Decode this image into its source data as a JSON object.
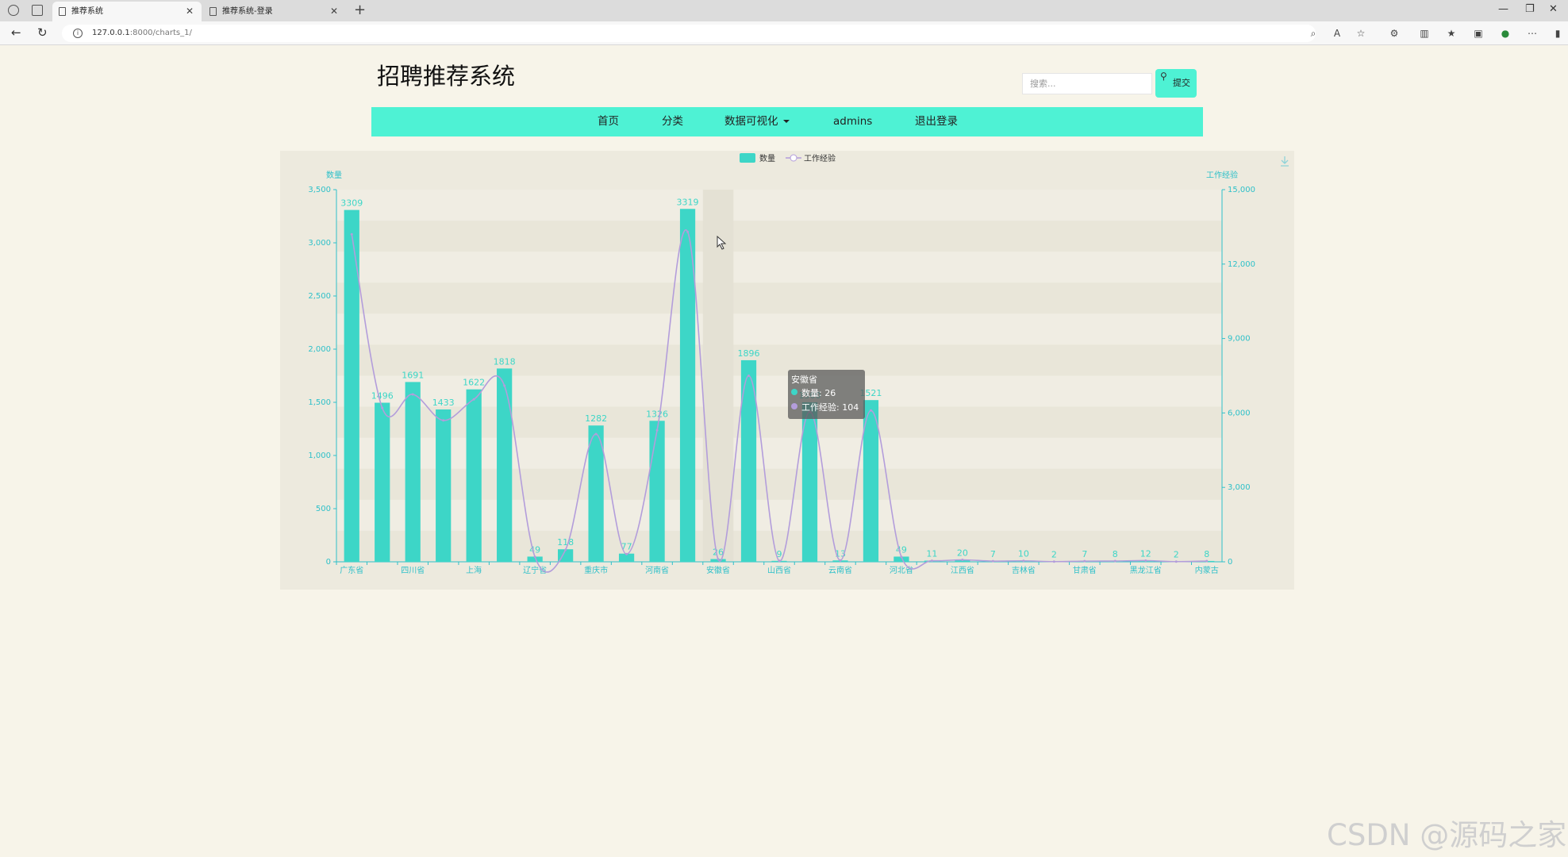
{
  "browser": {
    "tabs": [
      {
        "title": "推荐系统",
        "active": true
      },
      {
        "title": "推荐系统-登录",
        "active": false
      }
    ],
    "url_host": "127.0.0.1",
    "url_rest": ":8000/charts_1/"
  },
  "site": {
    "title": "招聘推荐系统",
    "search_placeholder": "搜索...",
    "search_button": "提交"
  },
  "nav": {
    "items": [
      "首页",
      "分类",
      "数据可视化",
      "admins",
      "退出登录"
    ]
  },
  "chart_data": {
    "type": "bar",
    "legend": [
      "数量",
      "工作经验"
    ],
    "ylabel_left": "数量",
    "ylabel_right": "工作经验",
    "ylim_left": [
      0,
      3500
    ],
    "ylim_right": [
      0,
      15000
    ],
    "yticks_left": [
      "0",
      "500",
      "1,000",
      "1,500",
      "2,000",
      "2,500",
      "3,000",
      "3,500"
    ],
    "yticks_right": [
      "0",
      "3,000",
      "6,000",
      "9,000",
      "12,000",
      "15,000"
    ],
    "categories": [
      "广东省",
      "",
      "四川省",
      "",
      "上海",
      "",
      "辽宁省",
      "",
      "重庆市",
      "",
      "河南省",
      "",
      "安徽省",
      "",
      "山西省",
      "",
      "云南省",
      "",
      "河北省",
      "",
      "江西省",
      "",
      "吉林省",
      "",
      "甘肃省",
      "",
      "黑龙江省",
      "",
      "内蒙古"
    ],
    "series": [
      {
        "name": "数量",
        "type": "bar",
        "color": "#3dd6c7",
        "values": [
          3309,
          1496,
          1691,
          1433,
          1622,
          1818,
          49,
          118,
          1282,
          77,
          1326,
          3319,
          26,
          1896,
          9,
          1500,
          13,
          1521,
          49,
          11,
          20,
          7,
          10,
          2,
          7,
          8,
          12,
          2,
          8
        ]
      },
      {
        "name": "工作经验",
        "type": "line",
        "color": "#b39ddb",
        "values": [
          13200,
          6200,
          6750,
          5700,
          6550,
          7100,
          200,
          480,
          5150,
          310,
          5300,
          13300,
          104,
          7500,
          40,
          6050,
          55,
          6100,
          200,
          44,
          80,
          28,
          40,
          8,
          28,
          32,
          48,
          8,
          32
        ]
      }
    ],
    "tooltip": {
      "title": "安徽省",
      "rows": [
        "数量: 26",
        "工作经验: 104"
      ]
    },
    "colors": {
      "bar": "#3dd6c7",
      "line": "#b39ddb",
      "axis": "#2ec0c9",
      "label": "#2ec0c9",
      "panel": "#edeade"
    }
  },
  "watermark": "CSDN @源码之家"
}
